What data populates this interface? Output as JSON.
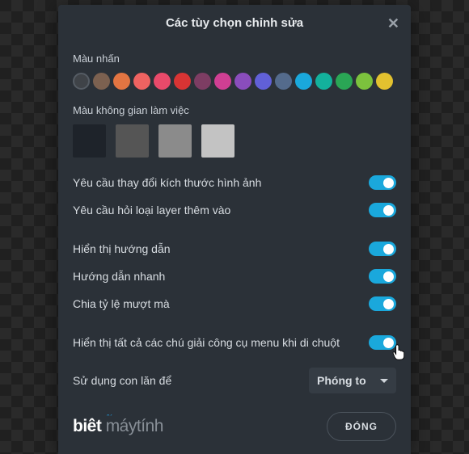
{
  "modal": {
    "title": "Các tùy chọn chỉnh sửa",
    "accent_label": "Màu nhấn",
    "workspace_label": "Màu không gian làm việc",
    "accent_colors": [
      {
        "hex": "#3f4348",
        "selected": true
      },
      {
        "hex": "#7c6150"
      },
      {
        "hex": "#e37542"
      },
      {
        "hex": "#ef6361"
      },
      {
        "hex": "#e94a6a"
      },
      {
        "hex": "#d83434"
      },
      {
        "hex": "#7d3d63"
      },
      {
        "hex": "#cf3f93"
      },
      {
        "hex": "#8a4dbc"
      },
      {
        "hex": "#6160d7"
      },
      {
        "hex": "#546b8c"
      },
      {
        "hex": "#1aa8dc"
      },
      {
        "hex": "#13b19c"
      },
      {
        "hex": "#2aa655"
      },
      {
        "hex": "#7cc23d"
      },
      {
        "hex": "#e2c12f"
      }
    ],
    "workspace_colors": [
      {
        "hex": "#1e232a"
      },
      {
        "hex": "#555555"
      },
      {
        "hex": "#8b8b8b"
      },
      {
        "hex": "#c3c3c3"
      }
    ],
    "toggles": [
      {
        "label": "Yêu cầu thay đổi kích thước hình ảnh",
        "on": true,
        "gap": true
      },
      {
        "label": "Yêu cầu hỏi loại layer thêm vào",
        "on": true
      },
      {
        "label": "Hiển thị hướng dẫn",
        "on": true,
        "gap": true
      },
      {
        "label": "Hướng dẫn nhanh",
        "on": true
      },
      {
        "label": "Chia tỷ lệ mượt mà",
        "on": true
      },
      {
        "label": "Hiển thị tất cả các chú giải công cụ menu khi di chuột",
        "on": true,
        "gap": true
      }
    ],
    "wheel_label": "Sử dụng con lăn để",
    "wheel_select": "Phóng to",
    "close_button": "ĐÓNG"
  },
  "brand": {
    "part1": "biêt",
    "part2": "máytính"
  }
}
